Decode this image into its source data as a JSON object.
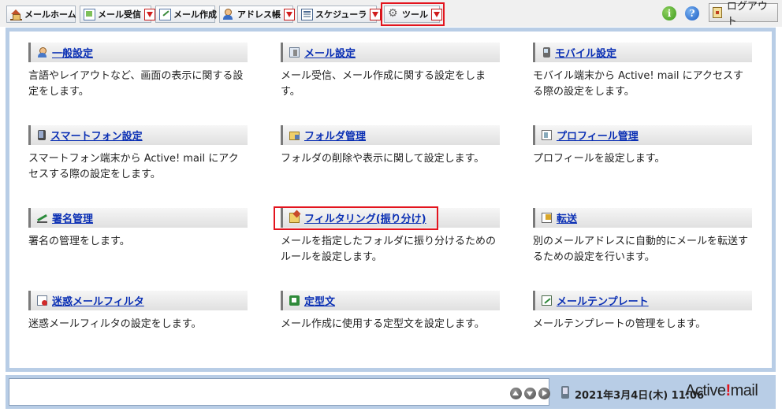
{
  "toolbar": {
    "mail_home": "メールホーム",
    "mail_receive": "メール受信",
    "mail_compose": "メール作成",
    "address_book": "アドレス帳",
    "scheduler": "スケジューラ",
    "tools": "ツール",
    "info_icon": "i",
    "help_icon": "?",
    "logout": "ログアウト"
  },
  "tiles": [
    {
      "title": "一般設定",
      "icon": "person-icon",
      "desc": "言語やレイアウトなど、画面の表示に関する設定をします。"
    },
    {
      "title": "メール設定",
      "icon": "mail-settings-icon",
      "desc": "メール受信、メール作成に関する設定をします。"
    },
    {
      "title": "モバイル設定",
      "icon": "mobile-icon",
      "desc": "モバイル端末から Active! mail にアクセスする際の設定をします。"
    },
    {
      "title": "スマートフォン設定",
      "icon": "smartphone-icon",
      "desc": "スマートフォン端末から Active! mail にアクセスする際の設定をします。"
    },
    {
      "title": "フォルダ管理",
      "icon": "folder-icon",
      "desc": "フォルダの削除や表示に関して設定します。"
    },
    {
      "title": "プロフィール管理",
      "icon": "profile-icon",
      "desc": "プロフィールを設定します。"
    },
    {
      "title": "署名管理",
      "icon": "signature-icon",
      "desc": "署名の管理をします。"
    },
    {
      "title": "フィルタリング(振り分け)",
      "icon": "filter-icon",
      "desc": "メールを指定したフォルダに振り分けるためのルールを設定します。"
    },
    {
      "title": "転送",
      "icon": "forward-icon",
      "desc": "別のメールアドレスに自動的にメールを転送するための設定を行います。"
    },
    {
      "title": "迷惑メールフィルタ",
      "icon": "spam-filter-icon",
      "desc": "迷惑メールフィルタの設定をします。"
    },
    {
      "title": "定型文",
      "icon": "fixed-phrase-icon",
      "desc": "メール作成に使用する定型文を設定します。"
    },
    {
      "title": "メールテンプレート",
      "icon": "mail-template-icon",
      "desc": "メールテンプレートの管理をします。"
    }
  ],
  "status": {
    "datetime": "2021年3月4日(木) 11:06",
    "logo_main": "Active",
    "logo_mark": "!",
    "logo_tail": "mail"
  },
  "colors": {
    "link": "#0a2fb4",
    "highlight_frame": "#e3141e",
    "panel_border": "#b8cde6"
  }
}
